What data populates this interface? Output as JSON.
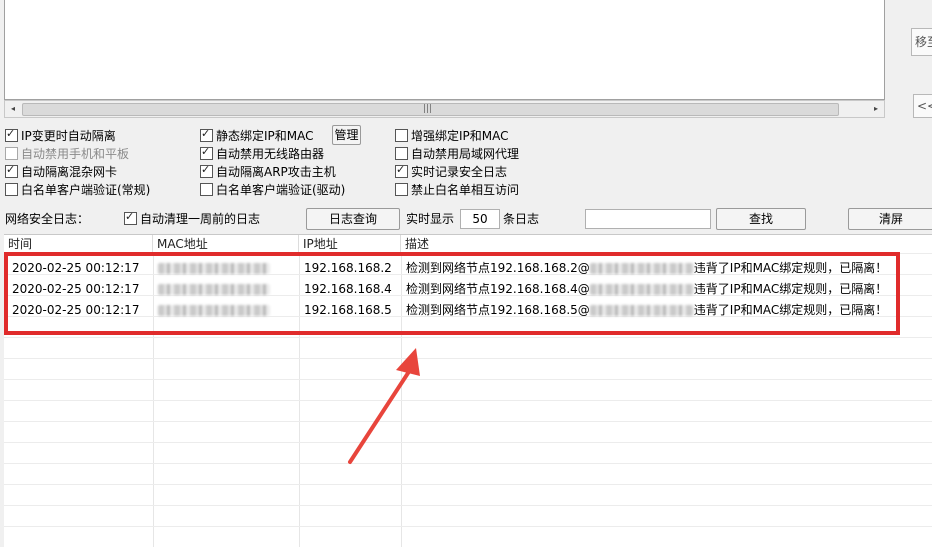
{
  "right_panel": {
    "move_button": "移至",
    "prev_button": "<<"
  },
  "scrollbar": {
    "left_arrow": "◂",
    "right_arrow": "▸",
    "grip": "|||"
  },
  "options": [
    {
      "label": "IP变更时自动隔离",
      "checked": true,
      "disabled": false
    },
    {
      "label": "静态绑定IP和MAC",
      "checked": true,
      "disabled": false
    },
    {
      "label": "增强绑定IP和MAC",
      "checked": false,
      "disabled": false
    },
    {
      "label": "自动禁用手机和平板",
      "checked": false,
      "disabled": true
    },
    {
      "label": "自动禁用无线路由器",
      "checked": true,
      "disabled": false
    },
    {
      "label": "自动禁用局域网代理",
      "checked": false,
      "disabled": false
    },
    {
      "label": "自动隔离混杂网卡",
      "checked": true,
      "disabled": false
    },
    {
      "label": "自动隔离ARP攻击主机",
      "checked": true,
      "disabled": false
    },
    {
      "label": "实时记录安全日志",
      "checked": true,
      "disabled": false
    },
    {
      "label": "白名单客户端验证(常规)",
      "checked": false,
      "disabled": false
    },
    {
      "label": "白名单客户端验证(驱动)",
      "checked": false,
      "disabled": false
    },
    {
      "label": "禁止白名单相互访问",
      "checked": false,
      "disabled": false
    }
  ],
  "manage_button": "管理",
  "log_bar": {
    "label": "网络安全日志：",
    "auto_clean_label": "自动清理一周前的日志",
    "auto_clean_checked": true,
    "query_button": "日志查询",
    "realtime_label": "实时显示",
    "realtime_count": "50",
    "count_suffix": "条日志",
    "search_value": "",
    "find_button": "查找",
    "clear_button": "清屏"
  },
  "table": {
    "columns": [
      "时间",
      "MAC地址",
      "IP地址",
      "描述"
    ],
    "rows": [
      {
        "time": "2020-02-25 00:12:17",
        "ip": "192.168.168.2",
        "desc_prefix": "检测到网络节点192.168.168.2@",
        "desc_suffix": "违背了IP和MAC绑定规则，已隔离！"
      },
      {
        "time": "2020-02-25 00:12:17",
        "ip": "192.168.168.4",
        "desc_prefix": "检测到网络节点192.168.168.4@",
        "desc_suffix": "违背了IP和MAC绑定规则，已隔离！"
      },
      {
        "time": "2020-02-25 00:12:17",
        "ip": "192.168.168.5",
        "desc_prefix": "检测到网络节点192.168.168.5@",
        "desc_suffix": "违背了IP和MAC绑定规则，已隔离！"
      }
    ]
  },
  "colors": {
    "highlight": "#e02b2b",
    "arrow": "#e8453c"
  },
  "annotation_icon": "red-arrow-icon"
}
